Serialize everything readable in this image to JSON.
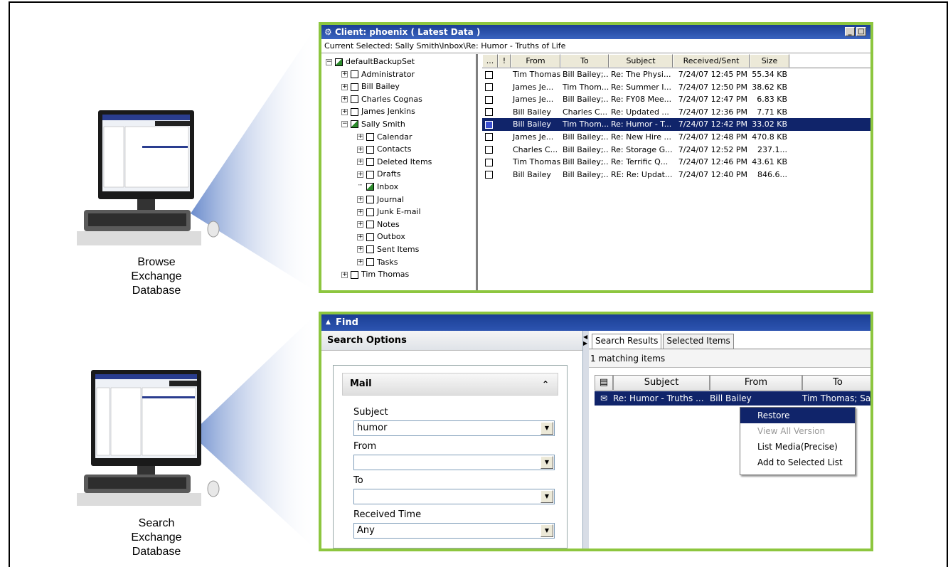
{
  "captions": {
    "browse": [
      "Browse",
      "Exchange",
      "Database"
    ],
    "search": [
      "Search",
      "Exchange",
      "Database"
    ]
  },
  "browse_window": {
    "title": "Client: phoenix ( Latest Data )",
    "buttons": [
      "_",
      "□"
    ],
    "current_selected": "Current Selected: Sally Smith\\Inbox\\Re: Humor - Truths of Life",
    "tree": [
      {
        "label": "defaultBackupSet",
        "level": 0,
        "exp": "−",
        "check": "partial"
      },
      {
        "label": "Administrator",
        "level": 1,
        "exp": "+",
        "check": "empty"
      },
      {
        "label": "Bill Bailey",
        "level": 1,
        "exp": "+",
        "check": "empty"
      },
      {
        "label": "Charles Cognas",
        "level": 1,
        "exp": "+",
        "check": "empty"
      },
      {
        "label": "James Jenkins",
        "level": 1,
        "exp": "+",
        "check": "empty"
      },
      {
        "label": "Sally Smith",
        "level": 1,
        "exp": "−",
        "check": "partial"
      },
      {
        "label": "Calendar",
        "level": 2,
        "exp": "+",
        "check": "empty"
      },
      {
        "label": "Contacts",
        "level": 2,
        "exp": "+",
        "check": "empty"
      },
      {
        "label": "Deleted Items",
        "level": 2,
        "exp": "+",
        "check": "empty"
      },
      {
        "label": "Drafts",
        "level": 2,
        "exp": "+",
        "check": "empty"
      },
      {
        "label": "Inbox",
        "level": 2,
        "exp": "",
        "check": "partial"
      },
      {
        "label": "Journal",
        "level": 2,
        "exp": "+",
        "check": "empty"
      },
      {
        "label": "Junk E-mail",
        "level": 2,
        "exp": "+",
        "check": "empty"
      },
      {
        "label": "Notes",
        "level": 2,
        "exp": "+",
        "check": "empty"
      },
      {
        "label": "Outbox",
        "level": 2,
        "exp": "+",
        "check": "empty"
      },
      {
        "label": "Sent Items",
        "level": 2,
        "exp": "+",
        "check": "empty"
      },
      {
        "label": "Tasks",
        "level": 2,
        "exp": "+",
        "check": "empty"
      },
      {
        "label": "Tim Thomas",
        "level": 1,
        "exp": "+",
        "check": "empty"
      }
    ],
    "columns": [
      "...",
      "!",
      "From",
      "To",
      "Subject",
      "Received/Sent",
      "Size"
    ],
    "rows": [
      {
        "from": "Tim Thomas",
        "to": "Bill Bailey;...",
        "subject": "Re: The Physi...",
        "date": "7/24/07 12:45 PM",
        "size": "55.34 KB"
      },
      {
        "from": "James Je...",
        "to": "Tim Thom...",
        "subject": "Re: Summer I...",
        "date": "7/24/07 12:50 PM",
        "size": "38.62 KB"
      },
      {
        "from": "James Je...",
        "to": "Bill Bailey;...",
        "subject": "Re: FY08 Mee...",
        "date": "7/24/07 12:47 PM",
        "size": "6.83 KB"
      },
      {
        "from": "Bill Bailey",
        "to": "Charles C...",
        "subject": "Re: Updated ...",
        "date": "7/24/07 12:36 PM",
        "size": "7.71 KB"
      },
      {
        "from": "Bill Bailey",
        "to": "Tim Thom...",
        "subject": "Re: Humor - T...",
        "date": "7/24/07 12:42 PM",
        "size": "33.02 KB",
        "selected": true
      },
      {
        "from": "James Je...",
        "to": "Bill Bailey;...",
        "subject": "Re: New Hire ...",
        "date": "7/24/07 12:48 PM",
        "size": "470.8 KB"
      },
      {
        "from": "Charles C...",
        "to": "Bill Bailey;...",
        "subject": "Re: Storage G...",
        "date": "7/24/07 12:52 PM",
        "size": "237.1..."
      },
      {
        "from": "Tim Thomas",
        "to": "Bill Bailey;...",
        "subject": "Re: Terrific Q...",
        "date": "7/24/07 12:46 PM",
        "size": "43.61 KB"
      },
      {
        "from": "Bill Bailey",
        "to": "Bill Bailey;...",
        "subject": "RE: Re: Updat...",
        "date": "7/24/07 12:40 PM",
        "size": "846.6..."
      }
    ]
  },
  "find_window": {
    "title": "Find",
    "search_options_title": "Search Options",
    "mail_section": "Mail",
    "fields": {
      "subject_label": "Subject",
      "subject_value": "humor",
      "from_label": "From",
      "from_value": "",
      "to_label": "To",
      "to_value": "",
      "received_label": "Received Time",
      "received_value": "Any"
    },
    "tabs": [
      "Search Results",
      "Selected Items"
    ],
    "matching": "1 matching items",
    "result_columns": [
      "Subject",
      "From",
      "To"
    ],
    "result_row": {
      "subject": "Re: Humor - Truths ...",
      "from": "Bill Bailey",
      "to": "Tim Thomas; Sa..."
    },
    "context_menu": [
      "Restore",
      "View All Version",
      "List Media(Precise)",
      "Add to Selected List"
    ]
  }
}
